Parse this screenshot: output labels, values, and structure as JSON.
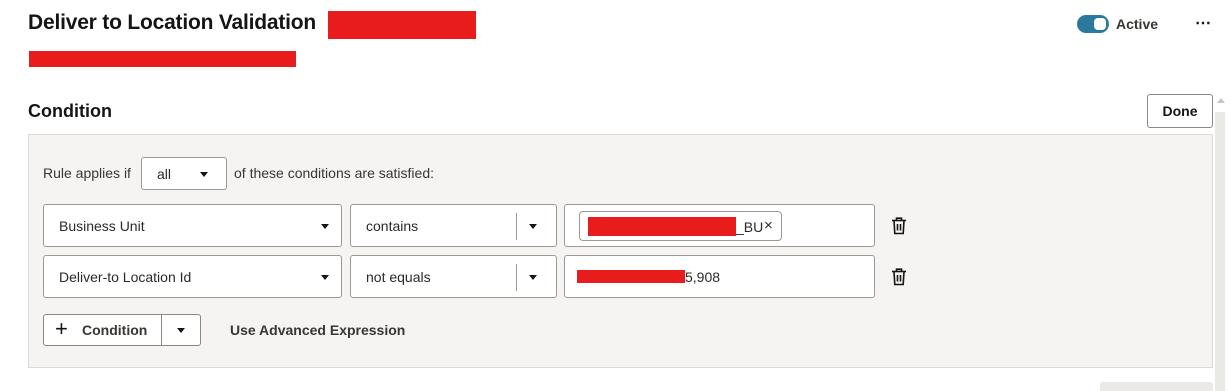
{
  "header": {
    "title": "Deliver to Location Validation",
    "status_label": "Active",
    "status_on": true,
    "more_label": "⋯",
    "accent_color": "#2b7a9b"
  },
  "condition_section": {
    "title": "Condition",
    "done_label": "Done",
    "rule_prefix": "Rule applies if",
    "match_mode": "all",
    "rule_suffix": "of these conditions are satisfied:",
    "rows": [
      {
        "field": "Business Unit",
        "operator": "contains",
        "value_chip_suffix": "_BU",
        "remove_chip": "×"
      },
      {
        "field": "Deliver-to Location Id",
        "operator": "not equals",
        "value_suffix": "5,908"
      }
    ],
    "add_condition_label": "Condition",
    "advanced_label": "Use Advanced Expression"
  },
  "redaction_color": "#e81c1c"
}
